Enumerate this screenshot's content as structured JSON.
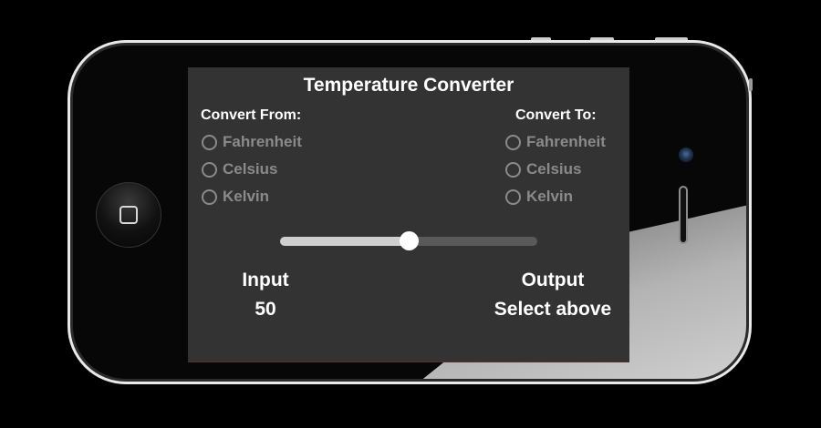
{
  "app": {
    "title": "Temperature Converter"
  },
  "convert_from": {
    "label": "Convert From:",
    "options": [
      "Fahrenheit",
      "Celsius",
      "Kelvin"
    ]
  },
  "convert_to": {
    "label": "Convert To:",
    "options": [
      "Fahrenheit",
      "Celsius",
      "Kelvin"
    ]
  },
  "slider": {
    "value": 50,
    "min": 0,
    "max": 100
  },
  "input": {
    "label": "Input",
    "value": "50"
  },
  "output": {
    "label": "Output",
    "value": "Select above"
  },
  "colors": {
    "screen_background": "#333333",
    "inactive_option": "#8a8a8a",
    "text": "#ffffff"
  }
}
